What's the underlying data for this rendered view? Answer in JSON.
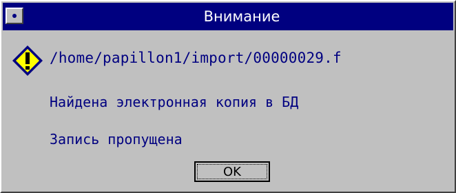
{
  "window": {
    "title": "Внимание"
  },
  "message": {
    "path": "/home/papillon1/import/00000029.f",
    "line2": "Найдена электронная копия в БД",
    "line3": "Запись пропущена"
  },
  "buttons": {
    "ok_label": "OK"
  },
  "icons": {
    "system_menu": "system-menu-icon",
    "warning": "warning-icon"
  },
  "colors": {
    "titlebar": "#000080",
    "text": "#000080",
    "background": "#c0c0c0",
    "warning_fill": "#ffff00"
  }
}
